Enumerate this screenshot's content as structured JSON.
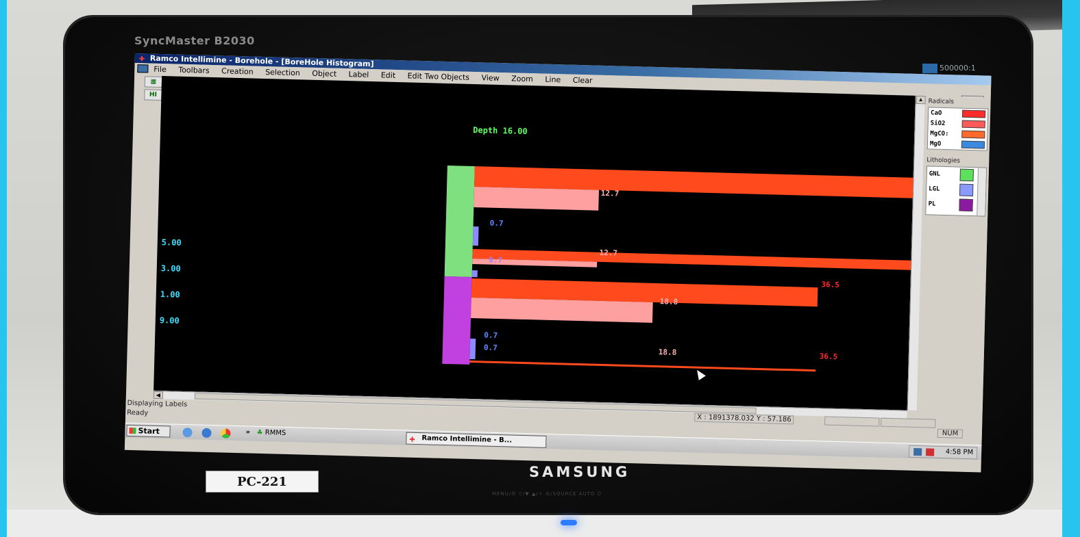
{
  "monitor": {
    "model": "SyncMaster B2030",
    "brand": "SAMSUNG",
    "asset_tag": "PC-221",
    "contrast_badge": "500000:1",
    "bezel_buttons": "MENU/☰   ▽/▼   ▲/☼   ⊟/SOURCE   AUTO   ⏻"
  },
  "app": {
    "title": "Ramco Intellimine - Borehole - [BoreHole Histogram]",
    "menu": [
      "File",
      "Toolbars",
      "Creation",
      "Selection",
      "Object",
      "Label",
      "Edit",
      "Edit Two Objects",
      "View",
      "Zoom",
      "Line",
      "Clear"
    ],
    "tool_buttons": [
      "▦",
      "HI"
    ]
  },
  "chart_data": {
    "type": "bar",
    "title": "Depth 16.00",
    "depth_labels": [
      "5.00",
      "3.00",
      "1.00",
      "9.00"
    ],
    "value_labels": [
      "12.7",
      "0.7",
      "12.7",
      "0.7",
      "36.5",
      "18.8",
      "0.7",
      "0.7",
      "18.8",
      "36.5"
    ],
    "series": [
      {
        "name": "CaO",
        "color": "#ff4a1e"
      },
      {
        "name": "SiO2",
        "color": "#ffa0a0"
      },
      {
        "name": "MgO",
        "color": "#8b8bff"
      }
    ],
    "lithology_intervals": [
      {
        "name": "GNL",
        "color": "#7ee07e"
      },
      {
        "name": "PL",
        "color": "#c040e0"
      }
    ]
  },
  "legend": {
    "radicals_title": "Radicals",
    "radicals": [
      {
        "name": "CaO",
        "color": "#ff2a2a"
      },
      {
        "name": "SiO2",
        "color": "#ff5a5a"
      },
      {
        "name": "MgCO:",
        "color": "#ff6a2a"
      },
      {
        "name": "MgO",
        "color": "#3a8ae0"
      }
    ],
    "lithologies_title": "Lithologies",
    "lithologies": [
      {
        "name": "GNL",
        "color": "#5ee05e"
      },
      {
        "name": "LGL",
        "color": "#8a9aff"
      },
      {
        "name": "PL",
        "color": "#8a1aa0"
      }
    ]
  },
  "status": {
    "message": "Displaying Labels",
    "ready": "Ready",
    "coords": "X : 1891378.032 Y : 57.186",
    "num": "NUM"
  },
  "taskbar": {
    "start": "Start",
    "quick_launch_more": "»",
    "pinned": "RMMS",
    "active_task": "Ramco Intellimine - B...",
    "clock": "4:58 PM"
  },
  "icons": {
    "cursor": "pointer-arrow-icon",
    "app": "ramco-icon",
    "start": "windows-flag-icon"
  }
}
